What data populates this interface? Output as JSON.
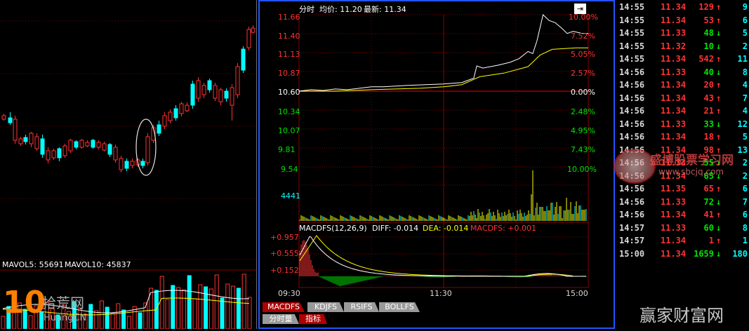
{
  "colors": {
    "up": "#ff3232",
    "down": "#00e600",
    "time_text": "#d8d8d8",
    "grid": "#7a0000",
    "price_line": "#ffffff",
    "avg_line": "#ffff00",
    "cyan": "#00ffff",
    "tab_active": "#b00000",
    "tab_inactive": "#9a9a9a"
  },
  "left_chart": {
    "mavol_label": "MAVOL5: 55691",
    "mavol10_label": "MAVOL10: 45837"
  },
  "main_chart": {
    "header": {
      "mode_label": "分时",
      "avg_price_label": "均价: 11.20",
      "latest_price_label": "最新: 11.34"
    },
    "price_ticks": [
      "11.66",
      "11.40",
      "11.13",
      "10.87",
      "10.60",
      "10.34",
      "10.07",
      "9.81",
      "9.54"
    ],
    "pct_ticks": [
      "10.00%",
      "7.52%",
      "5.05%",
      "2.57%",
      "0.00%",
      "2.48%",
      "4.95%",
      "7.43%",
      "10.00%"
    ],
    "volume_tick": "4441",
    "macd": {
      "header_label": "MACDFS(12,26,9)",
      "diff_label": "DIFF: -0.014",
      "dea_label": "DEA: -0.014",
      "macdfs_label": "MACDFS: +0.001",
      "y_ticks": [
        "+0.957",
        "+0.555",
        "+0.152"
      ]
    },
    "time_ticks": [
      "09:30",
      "11:30",
      "15:00"
    ],
    "indicator_tabs": [
      "MACDFS",
      "KDJFS",
      "RSIFS",
      "BOLLFS"
    ],
    "bottom_tabs": [
      "分时量",
      "指标"
    ]
  },
  "ticks": [
    {
      "time": "14:55",
      "price": "11.34",
      "volume": "129",
      "dir": "up",
      "count": "9"
    },
    {
      "time": "14:55",
      "price": "11.34",
      "volume": "53",
      "dir": "up",
      "count": "6"
    },
    {
      "time": "14:55",
      "price": "11.33",
      "volume": "48",
      "dir": "down",
      "count": "5"
    },
    {
      "time": "14:55",
      "price": "11.32",
      "volume": "10",
      "dir": "down",
      "count": "2"
    },
    {
      "time": "14:55",
      "price": "11.34",
      "volume": "542",
      "dir": "up",
      "count": "11"
    },
    {
      "time": "14:56",
      "price": "11.33",
      "volume": "40",
      "dir": "down",
      "count": "8"
    },
    {
      "time": "14:56",
      "price": "11.34",
      "volume": "20",
      "dir": "up",
      "count": "4"
    },
    {
      "time": "14:56",
      "price": "11.34",
      "volume": "43",
      "dir": "up",
      "count": "7"
    },
    {
      "time": "14:56",
      "price": "11.34",
      "volume": "21",
      "dir": "up",
      "count": "4"
    },
    {
      "time": "14:56",
      "price": "11.33",
      "volume": "33",
      "dir": "down",
      "count": "12"
    },
    {
      "time": "14:56",
      "price": "11.34",
      "volume": "18",
      "dir": "up",
      "count": "5"
    },
    {
      "time": "14:56",
      "price": "11.34",
      "volume": "98",
      "dir": "up",
      "count": "13"
    },
    {
      "time": "14:56",
      "price": "11.33",
      "volume": "55",
      "dir": "down",
      "count": "2"
    },
    {
      "time": "14:56",
      "price": "11.34",
      "volume": "65",
      "dir": "down",
      "count": "2"
    },
    {
      "time": "14:56",
      "price": "11.35",
      "volume": "65",
      "dir": "up",
      "count": "6"
    },
    {
      "time": "14:56",
      "price": "11.33",
      "volume": "72",
      "dir": "down",
      "count": "7"
    },
    {
      "time": "14:56",
      "price": "11.34",
      "volume": "41",
      "dir": "up",
      "count": "6"
    },
    {
      "time": "14:57",
      "price": "11.33",
      "volume": "60",
      "dir": "down",
      "count": "8"
    },
    {
      "time": "14:57",
      "price": "11.34",
      "volume": "1",
      "dir": "up",
      "count": "1"
    },
    {
      "time": "15:00",
      "price": "11.34",
      "volume": "1659",
      "dir": "down",
      "count": "180"
    }
  ],
  "watermarks": {
    "left_logo_text": "拾荒网",
    "left_logo_sub": "HuangCN",
    "center_logo_text": "盛博股票学习网",
    "center_logo_url": "www.sbcjq.com",
    "bottom_right": "赢家财富网"
  }
}
